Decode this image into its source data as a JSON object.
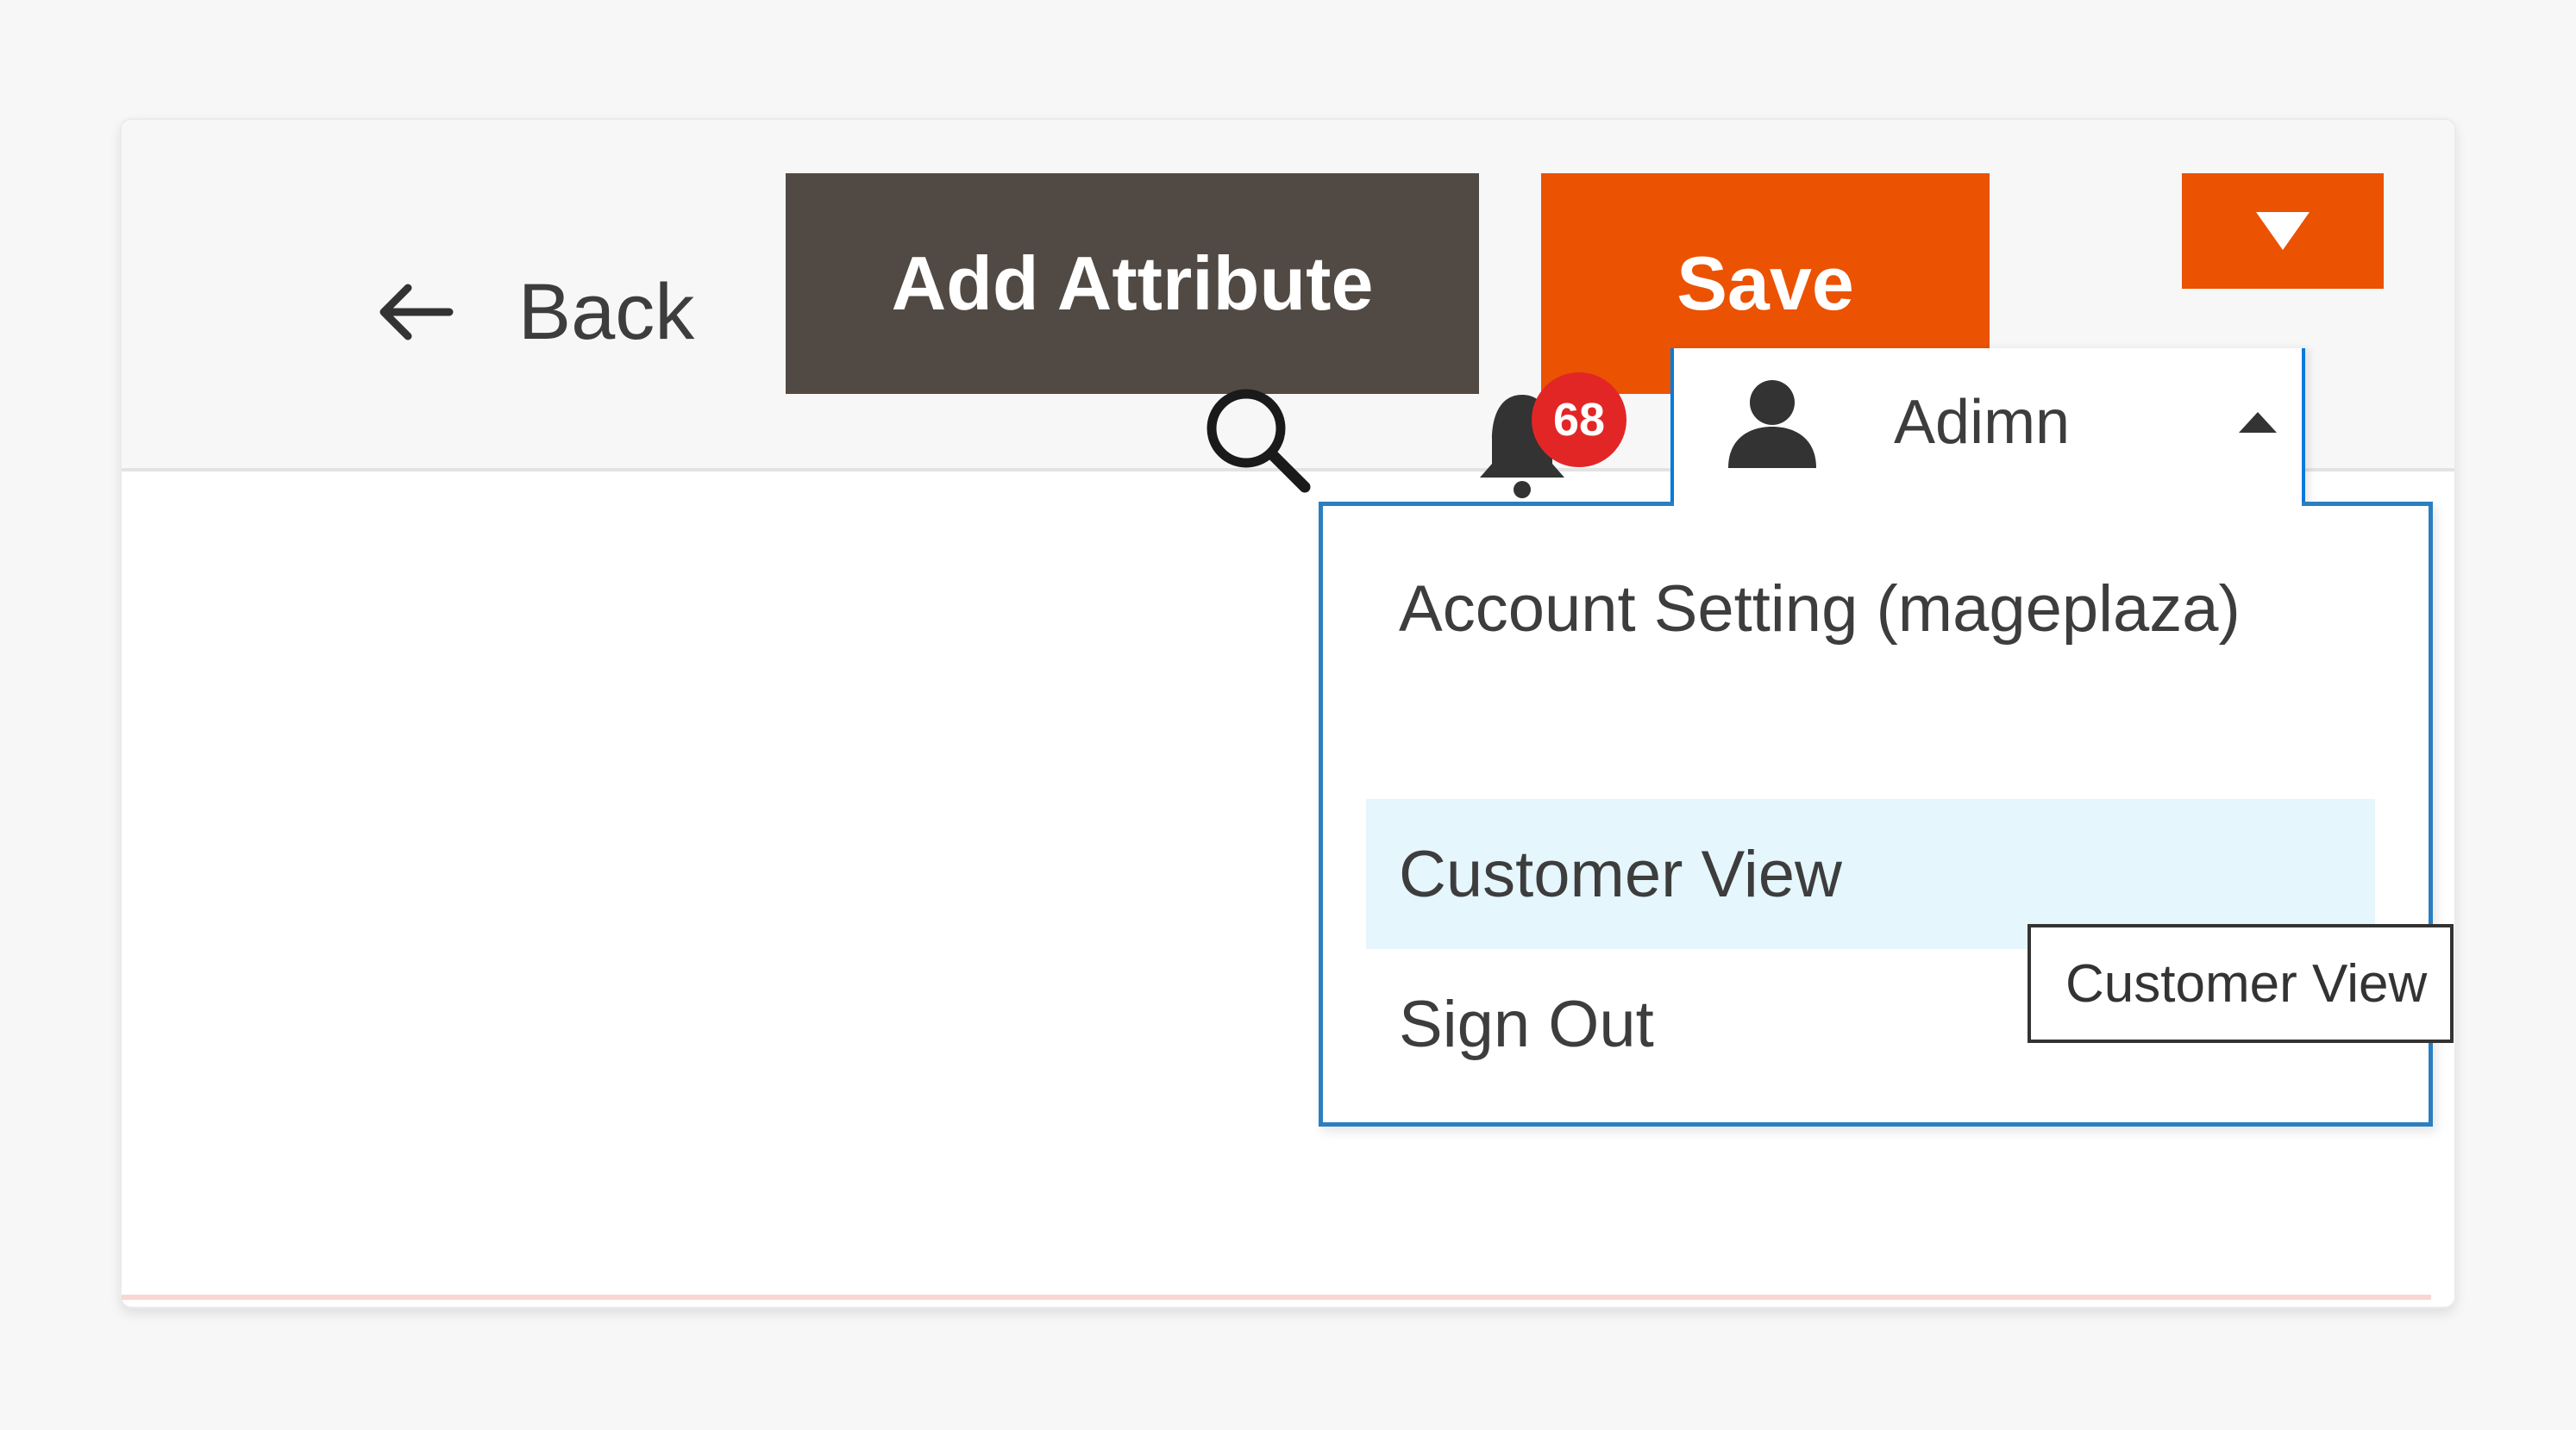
{
  "toolbar": {
    "back_label": "Back",
    "add_attribute_label": "Add Attribute",
    "save_label": "Save"
  },
  "header": {
    "notification_count": "68",
    "user_name": "Adimn"
  },
  "user_menu": {
    "items": [
      {
        "label": "Account Setting (mageplaza)",
        "highlighted": false
      },
      {
        "label": "Customer View",
        "highlighted": true
      },
      {
        "label": "Sign Out",
        "highlighted": false
      }
    ],
    "tooltip": "Customer View"
  },
  "colors": {
    "primary_dark": "#514943",
    "accent_orange": "#eb5202",
    "badge_red": "#e22626",
    "dropdown_border": "#2b7fc1",
    "highlight_bg": "#e5f6fd"
  },
  "icons": {
    "back": "arrow-left-icon",
    "split": "triangle-down-icon",
    "search": "search-icon",
    "bell": "bell-icon",
    "user": "user-icon",
    "caret": "triangle-up-icon"
  }
}
